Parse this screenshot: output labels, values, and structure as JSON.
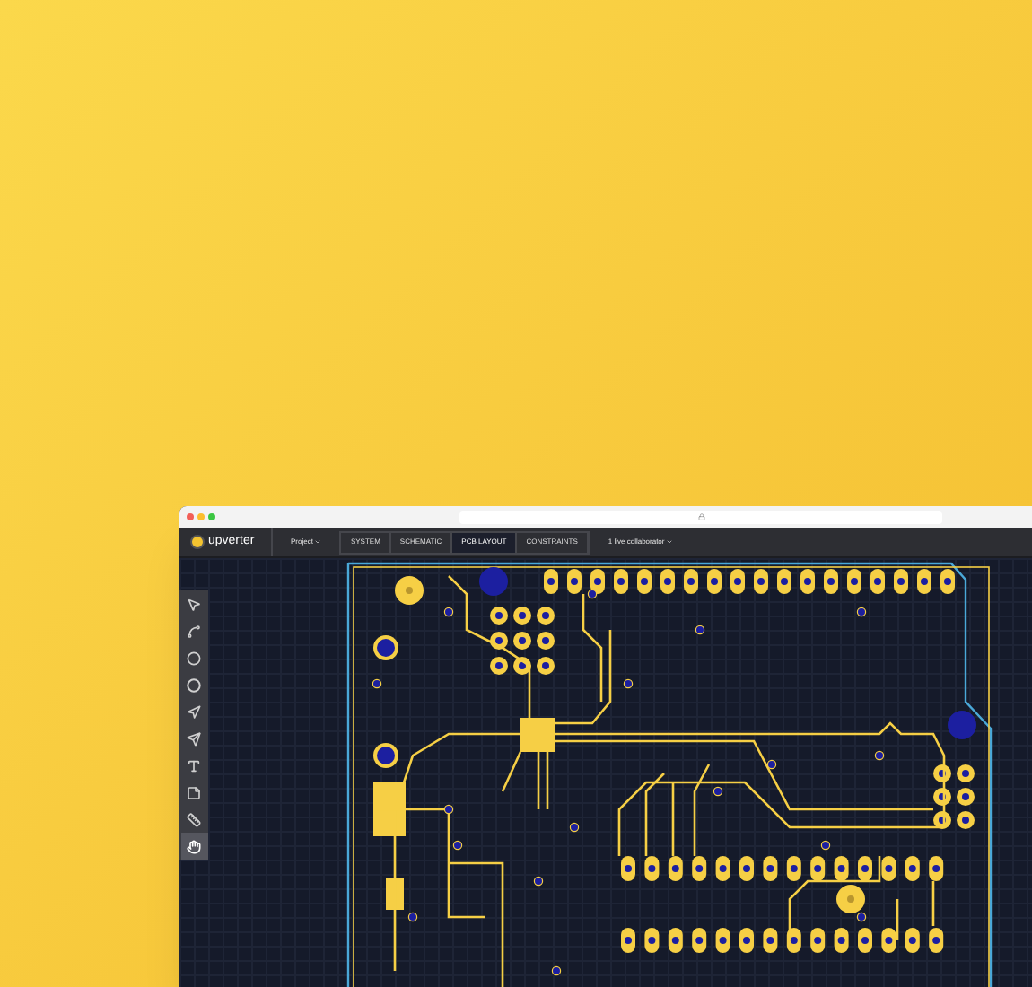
{
  "toolbar": {
    "logo": "upverter",
    "project_menu": "Project",
    "tabs": [
      {
        "label": "SYSTEM",
        "selected": false
      },
      {
        "label": "SCHEMATIC",
        "selected": false
      },
      {
        "label": "PCB LAYOUT",
        "selected": true
      },
      {
        "label": "CONSTRAINTS",
        "selected": false
      }
    ],
    "collaborators": "1 live collaborator"
  },
  "tools": [
    {
      "kind": "select",
      "selected": false
    },
    {
      "kind": "arc",
      "selected": false
    },
    {
      "kind": "circle",
      "selected": false
    },
    {
      "kind": "ring",
      "selected": false
    },
    {
      "kind": "route",
      "selected": false
    },
    {
      "kind": "route-diff",
      "selected": false
    },
    {
      "kind": "text",
      "selected": false
    },
    {
      "kind": "note",
      "selected": false
    },
    {
      "kind": "measure",
      "selected": false
    },
    {
      "kind": "pan",
      "selected": true
    }
  ]
}
